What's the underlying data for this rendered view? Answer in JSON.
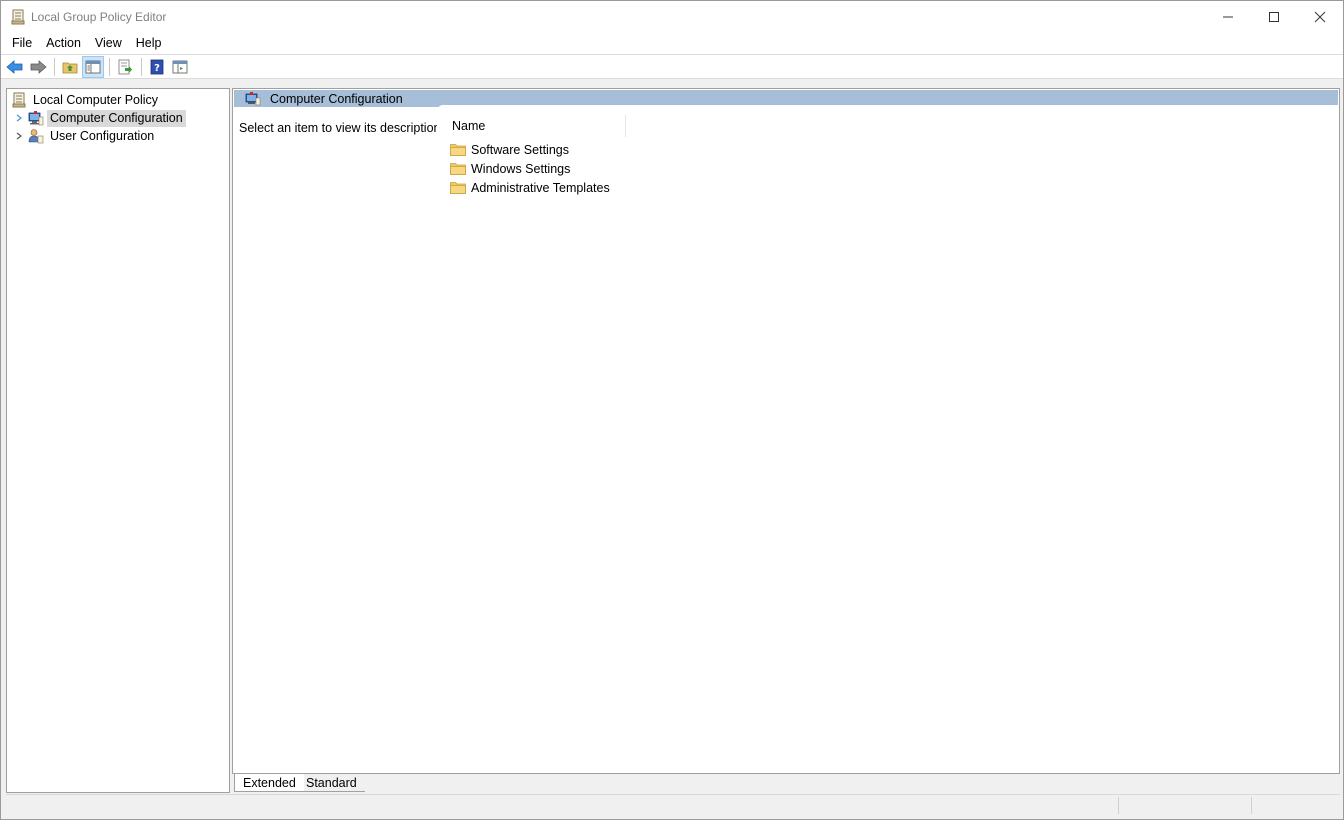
{
  "window": {
    "title": "Local Group Policy Editor"
  },
  "menu": {
    "items": [
      "File",
      "Action",
      "View",
      "Help"
    ]
  },
  "toolbar": {
    "buttons": [
      {
        "name": "back-icon"
      },
      {
        "name": "forward-icon"
      },
      {
        "name": "up-folder-icon"
      },
      {
        "name": "show-hide-tree-icon"
      },
      {
        "name": "export-list-icon"
      },
      {
        "name": "help-icon"
      },
      {
        "name": "properties-icon"
      }
    ]
  },
  "tree": {
    "root": "Local Computer Policy",
    "items": [
      {
        "label": "Computer Configuration",
        "selected": true
      },
      {
        "label": "User Configuration",
        "selected": false
      }
    ]
  },
  "content": {
    "header_title": "Computer Configuration",
    "description": "Select an item to view its description.",
    "column_name": "Name",
    "items": [
      "Software Settings",
      "Windows Settings",
      "Administrative Templates"
    ]
  },
  "tabs": {
    "extended": "Extended",
    "standard": "Standard"
  },
  "colors": {
    "header_band": "#a6bed8",
    "selection": "#d9d9d9",
    "folder": "#f2c966"
  }
}
